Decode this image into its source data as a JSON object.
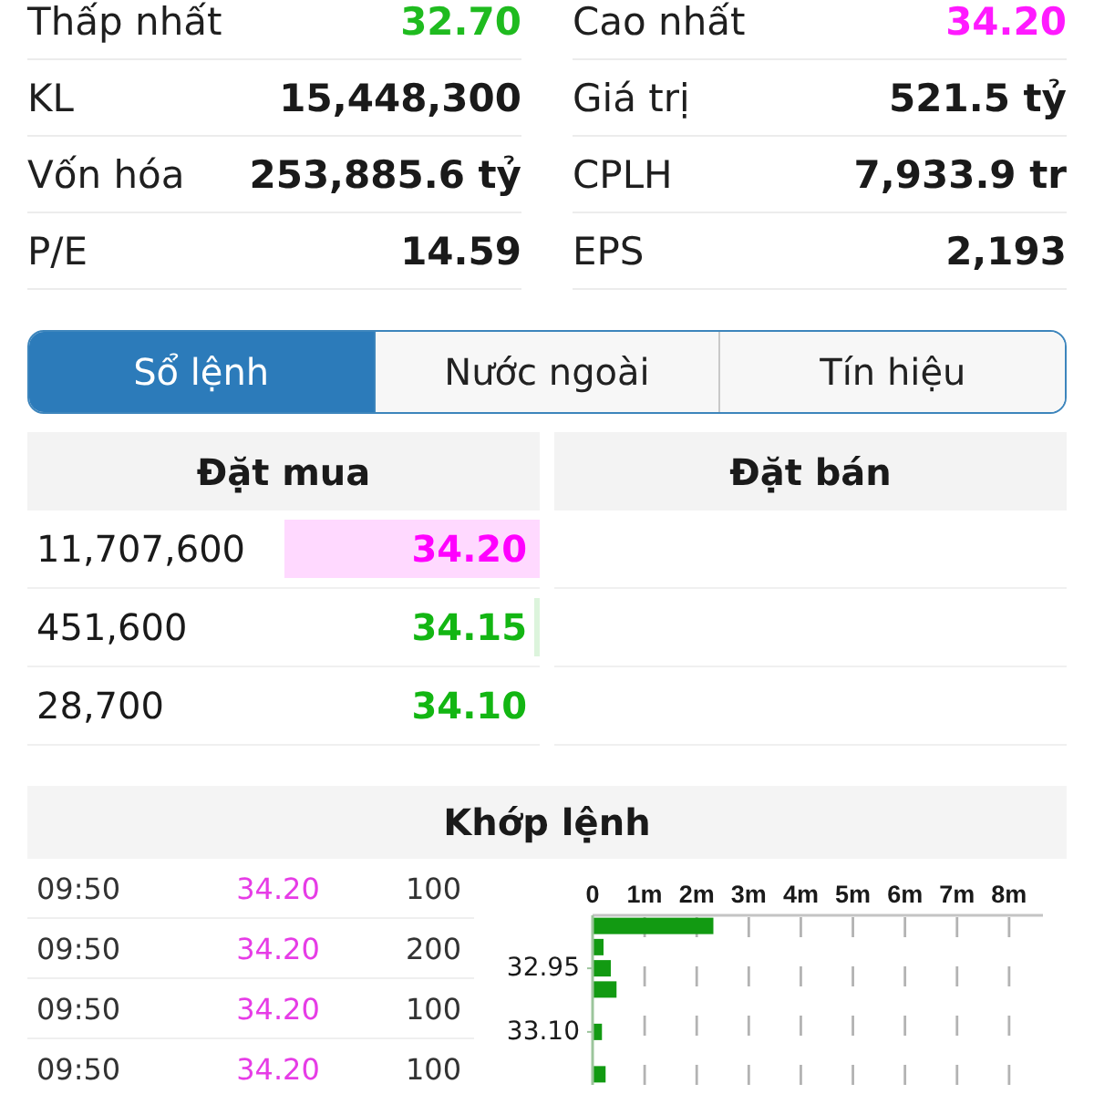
{
  "stats": [
    {
      "label": "Thấp nhất",
      "value": "32.70",
      "color": "#1fbb1f"
    },
    {
      "label": "Cao nhất",
      "value": "34.20",
      "color": "#ff1aff"
    },
    {
      "label": "KL",
      "value": "15,448,300",
      "color": "#1a1a1a"
    },
    {
      "label": "Giá trị",
      "value": "521.5 tỷ",
      "color": "#1a1a1a"
    },
    {
      "label": "Vốn hóa",
      "value": "253,885.6 tỷ",
      "color": "#1a1a1a"
    },
    {
      "label": "CPLH",
      "value": "7,933.9 tr",
      "color": "#1a1a1a"
    },
    {
      "label": "P/E",
      "value": "14.59",
      "color": "#1a1a1a"
    },
    {
      "label": "EPS",
      "value": "2,193",
      "color": "#1a1a1a"
    }
  ],
  "tabs": [
    {
      "label": "Sổ lệnh",
      "selected": true
    },
    {
      "label": "Nước ngoài",
      "selected": false
    },
    {
      "label": "Tín hiệu",
      "selected": false
    }
  ],
  "order_book": {
    "buy": {
      "title": "Đặt mua",
      "rows": [
        {
          "volume": "11,707,600",
          "price": "34.20",
          "color": "#ff00ff",
          "level": 0.5
        },
        {
          "volume": "451,600",
          "price": "34.15",
          "color": "#13b613",
          "level": 0.012
        },
        {
          "volume": "28,700",
          "price": "34.10",
          "color": "#13b613",
          "level": 0
        }
      ]
    },
    "sell": {
      "title": "Đặt bán"
    }
  },
  "matches": {
    "title": "Khớp lệnh",
    "trades": [
      {
        "time": "09:50",
        "price": "34.20",
        "volume": "100",
        "color": "#e63ce6"
      },
      {
        "time": "09:50",
        "price": "34.20",
        "volume": "200",
        "color": "#e63ce6"
      },
      {
        "time": "09:50",
        "price": "34.20",
        "volume": "100",
        "color": "#e63ce6"
      },
      {
        "time": "09:50",
        "price": "34.20",
        "volume": "100",
        "color": "#e63ce6"
      }
    ],
    "chart_data": {
      "type": "bar",
      "orientation": "horizontal",
      "x": [
        32.85,
        32.9,
        32.95,
        33.0,
        33.1,
        33.2
      ],
      "values": [
        2320000,
        210000,
        350000,
        460000,
        180000,
        250000
      ],
      "xlim": [
        0,
        8650000
      ],
      "xticks": [
        {
          "value": 0,
          "label": "0"
        },
        {
          "value": 1000000,
          "label": "1m"
        },
        {
          "value": 2000000,
          "label": "2m"
        },
        {
          "value": 3000000,
          "label": "3m"
        },
        {
          "value": 4000000,
          "label": "4m"
        },
        {
          "value": 5000000,
          "label": "5m"
        },
        {
          "value": 6000000,
          "label": "6m"
        },
        {
          "value": 7000000,
          "label": "7m"
        },
        {
          "value": 8000000,
          "label": "8m"
        }
      ],
      "ylim": [
        33.225,
        32.825
      ],
      "yticks": [
        {
          "value": 32.95,
          "label": "32.95"
        },
        {
          "value": 33.1,
          "label": "33.10"
        }
      ],
      "grid": true
    }
  }
}
